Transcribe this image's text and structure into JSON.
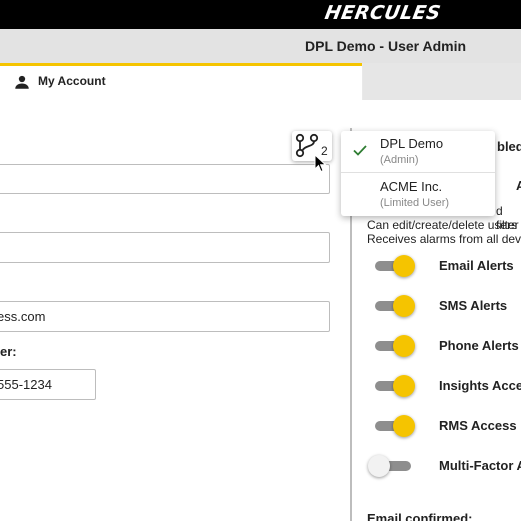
{
  "header": {
    "logo_text": "HERCULES",
    "page_title": "DPL Demo - User Admin"
  },
  "tabs": [
    {
      "label": "My Account",
      "icon": "person-icon",
      "active": true
    }
  ],
  "form": {
    "field1_value": "",
    "field2_value": "",
    "email_value": "ess.com",
    "phone_label": "er:",
    "phone_value": "555-1234"
  },
  "account_switcher": {
    "icon": "branch-icon",
    "count": "2"
  },
  "account_menu": [
    {
      "name": "DPL Demo",
      "role": "(Admin)",
      "selected": true
    },
    {
      "name": "ACME Inc.",
      "role": "(Limited User)",
      "selected": false
    }
  ],
  "permissions": {
    "enabled_label_partial": "bled",
    "a_partial": "A",
    "filter_partial": "d filter",
    "line1": "Can edit/create/delete users",
    "line2": "Receives alarms from all devi"
  },
  "toggles": [
    {
      "label": "Email Alerts",
      "on": true
    },
    {
      "label": "SMS Alerts",
      "on": true
    },
    {
      "label": "Phone Alerts",
      "on": true
    },
    {
      "label": "Insights Acce",
      "on": true
    },
    {
      "label": "RMS Access",
      "on": true
    },
    {
      "label": "Multi-Factor A",
      "on": false
    }
  ],
  "email_confirmed_label": "Email confirmed:",
  "colors": {
    "accent": "#f5c400",
    "topbar": "#000000",
    "titlebar": "#e3e3e3",
    "check": "#2e7d32"
  }
}
